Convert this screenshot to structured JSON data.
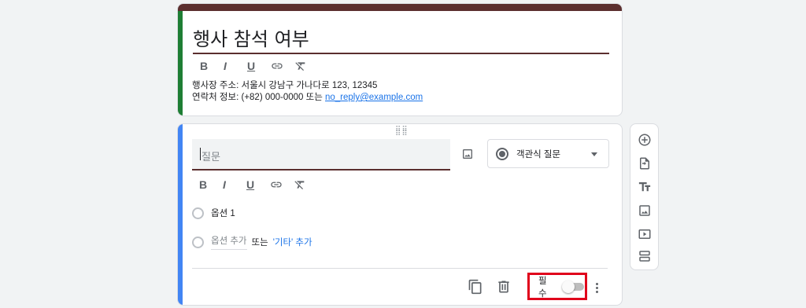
{
  "form": {
    "title": "행사 참석 여부",
    "description_line1": "행사장 주소: 서울시 강남구 가나다로 123, 12345",
    "description_line2_prefix": "연락처 정보: (+82) 000-0000 또는 ",
    "email": "no_reply@example.com",
    "format_buttons": [
      "B",
      "I",
      "U"
    ]
  },
  "question": {
    "placeholder": "질문",
    "type_label": "객관식 질문",
    "option1": "옵션 1",
    "add_option": "옵션 추가",
    "or_text": "또는",
    "add_other": "'기타' 추가",
    "required_label": "필수",
    "required_on": false
  },
  "icons": {
    "format": [
      "bold-icon",
      "italic-icon",
      "underline-icon",
      "link-icon",
      "clear-format-icon"
    ],
    "side_toolbar": [
      "add-question-icon",
      "import-questions-icon",
      "add-title-icon",
      "add-image-icon",
      "add-video-icon",
      "add-section-icon"
    ]
  },
  "colors": {
    "theme": "#5b2e2e",
    "title_accent": "#1e7e34",
    "question_accent": "#4285f4",
    "highlight": "#e0001b",
    "link": "#1a73e8"
  }
}
